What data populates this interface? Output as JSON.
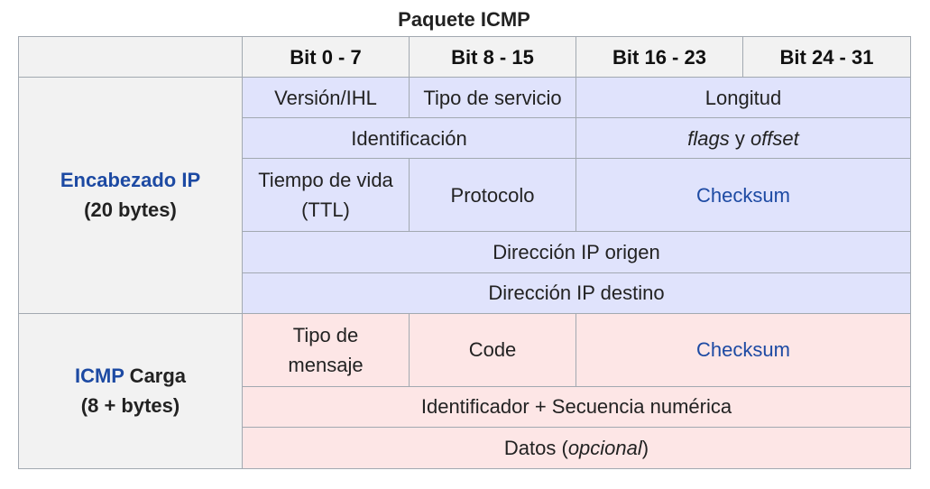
{
  "caption": "Paquete ICMP",
  "columns": [
    "Bit 0 - 7",
    "Bit 8 - 15",
    "Bit 16 - 23",
    "Bit 24 - 31"
  ],
  "ip_header": {
    "title": "Encabezado IP",
    "size": "(20 bytes)",
    "version_ihl": "Versión/IHL",
    "service_type": "Tipo de servicio",
    "length": "Longitud",
    "identification": "Identificación",
    "flags": "flags",
    "flags_conj": " y ",
    "offset": "offset",
    "ttl_line1": "Tiempo de vida",
    "ttl_line2": "(TTL)",
    "protocol": "Protocolo",
    "checksum": "Checksum",
    "source_ip": "Dirección IP origen",
    "dest_ip": "Dirección IP destino"
  },
  "icmp_payload": {
    "title_link": "ICMP",
    "title_rest": " Carga",
    "size": "(8 + bytes)",
    "message_type_line1": "Tipo de",
    "message_type_line2": "mensaje",
    "code": "Code",
    "checksum": "Checksum",
    "id_sequence": "Identificador + Secuencia numérica",
    "data_label": "Datos (",
    "data_optional": "opcional",
    "data_close": ")"
  },
  "colors": {
    "ip_section": "#e0e3fc",
    "icmp_section": "#fde6e6",
    "header_gray": "#f2f2f2",
    "link_blue": "#1d4aa3",
    "border": "#a2a9b1"
  }
}
